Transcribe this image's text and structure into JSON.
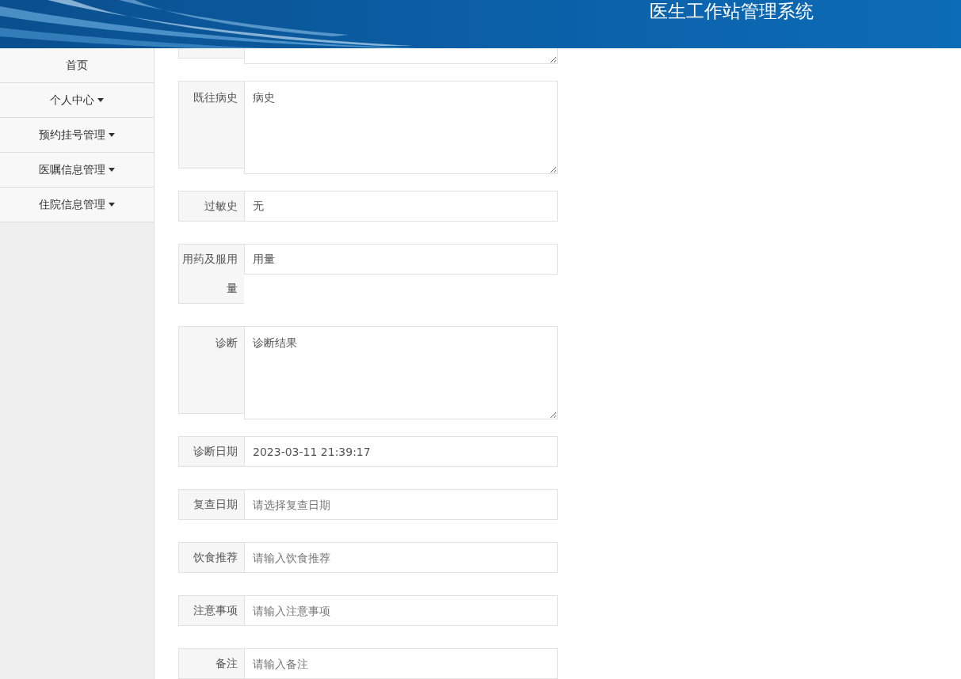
{
  "header": {
    "title": "医生工作站管理系统"
  },
  "sidebar": {
    "items": [
      {
        "label": "首页",
        "kind": "link"
      },
      {
        "label": "个人中心",
        "kind": "dropdown"
      },
      {
        "label": "预约挂号管理",
        "kind": "dropdown"
      },
      {
        "label": "医嘱信息管理",
        "kind": "dropdown"
      },
      {
        "label": "住院信息管理",
        "kind": "dropdown"
      }
    ]
  },
  "form": {
    "fields": [
      {
        "kind": "textarea"
      },
      {
        "kind": "textarea",
        "label": "既往病史",
        "value": "病史"
      },
      {
        "kind": "input",
        "label": "过敏史",
        "value": "无"
      },
      {
        "kind": "input",
        "label": "用药及服用量",
        "value": "用量"
      },
      {
        "kind": "textarea",
        "label": "诊断",
        "value": "诊断结果"
      },
      {
        "kind": "input",
        "label": "诊断日期",
        "value": "2023-03-11 21:39:17"
      },
      {
        "kind": "input",
        "label": "复查日期",
        "placeholder": "请选择复查日期"
      },
      {
        "kind": "input",
        "label": "饮食推荐",
        "placeholder": "请输入饮食推荐"
      },
      {
        "kind": "input",
        "label": "注意事项",
        "placeholder": "请输入注意事项"
      },
      {
        "kind": "input",
        "label": "备注",
        "placeholder": "请输入备注"
      }
    ]
  }
}
